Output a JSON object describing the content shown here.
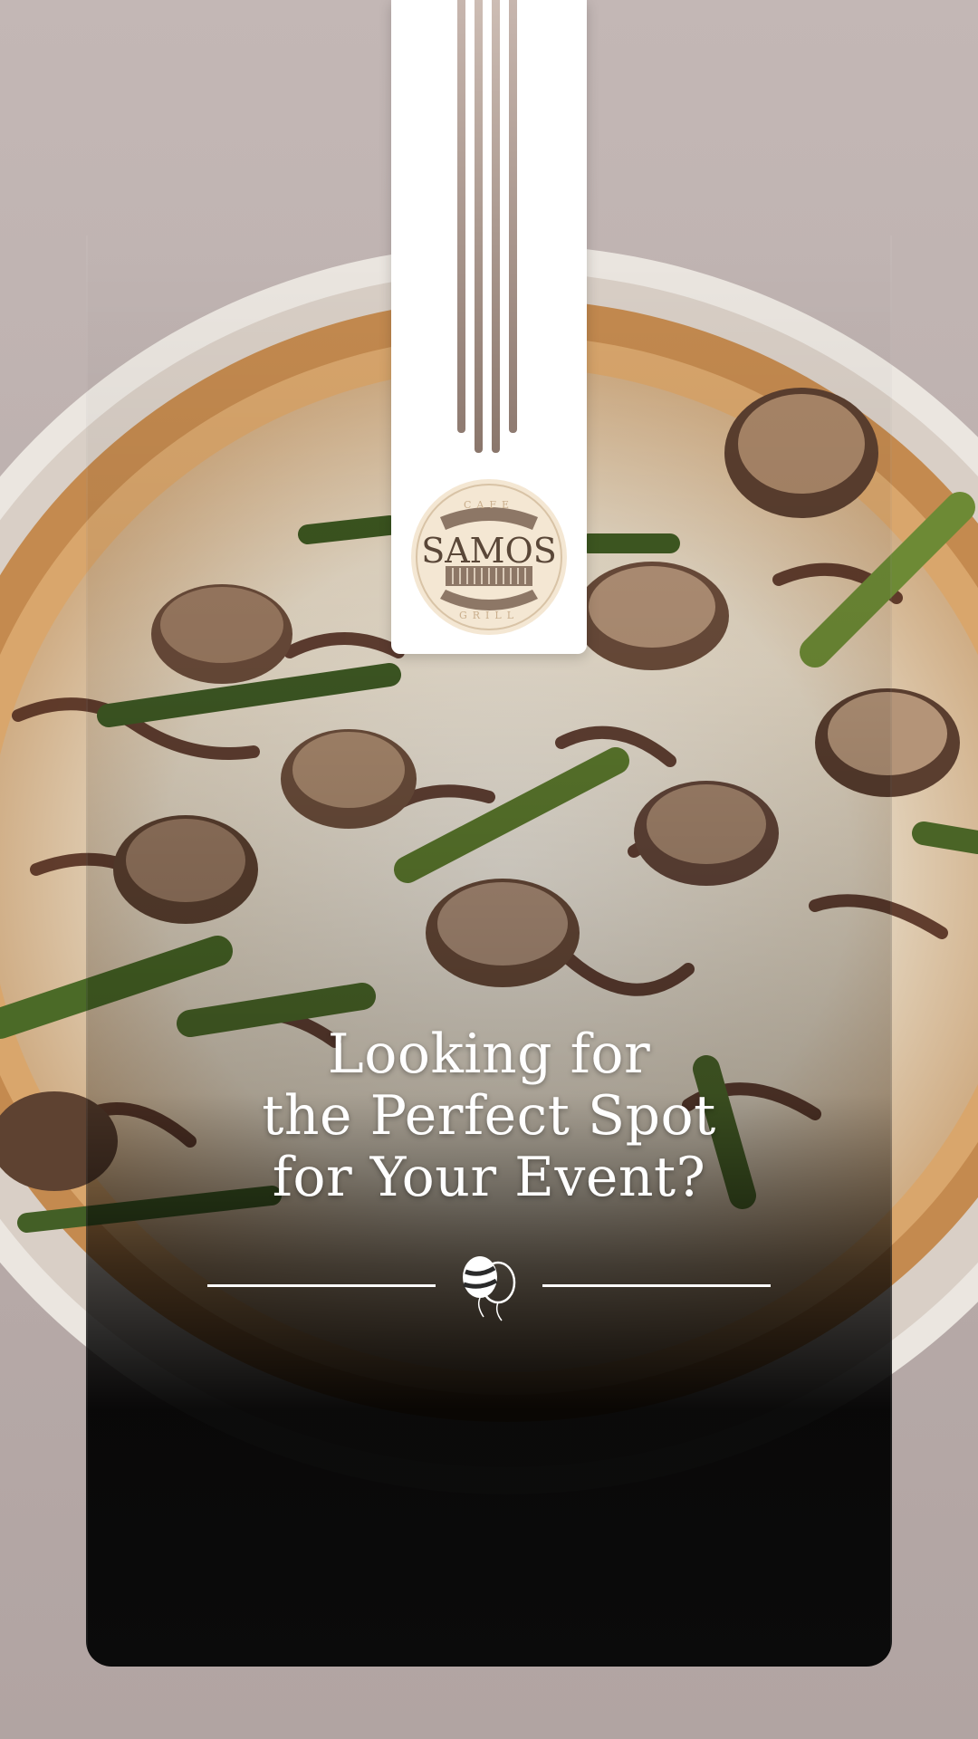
{
  "poster": {
    "headline_lines": [
      "Looking for",
      "the Perfect Spot",
      "for Your Event?"
    ]
  },
  "logo": {
    "name": "SAMOS",
    "top_word": "CAFE",
    "bottom_word": "GRILL"
  },
  "colors": {
    "background": "#b9adab",
    "banner": "#ffffff",
    "stripe": "#8a786e",
    "logo_fill": "#f4e7d3",
    "logo_ink": "#5a4738",
    "headline_text": "#ffffff"
  },
  "icons": {
    "divider": "balloons-icon"
  }
}
